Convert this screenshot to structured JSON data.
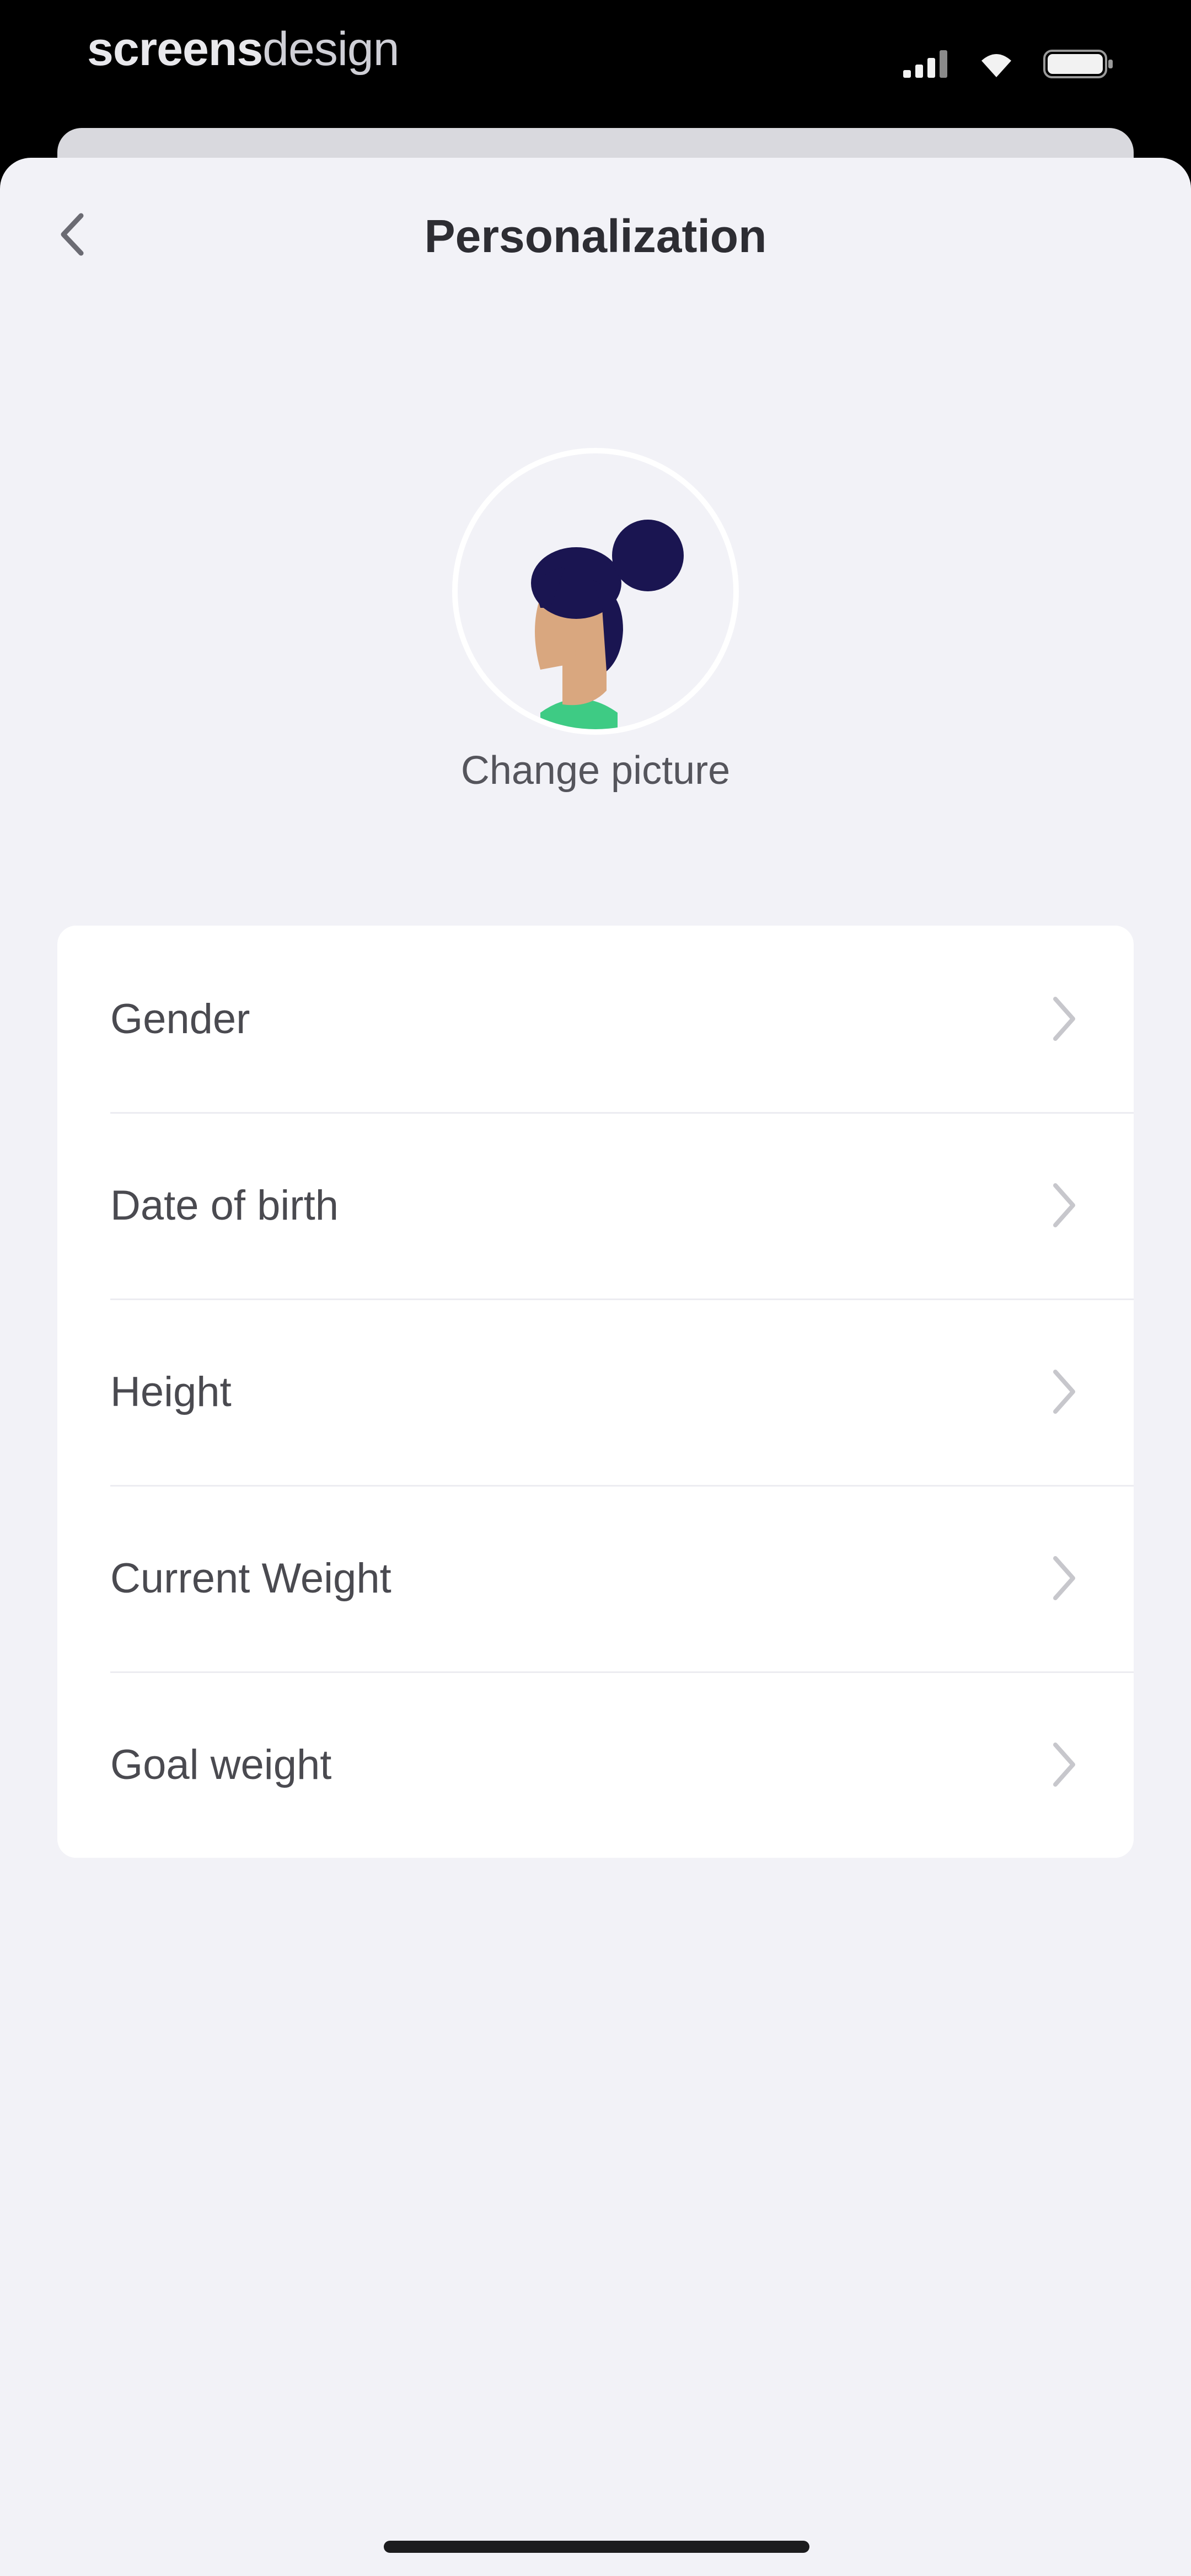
{
  "status_bar": {
    "brand_bold": "screens",
    "brand_light": "design",
    "icons": [
      "cellular-signal-icon",
      "wifi-icon",
      "battery-icon"
    ]
  },
  "nav": {
    "title": "Personalization",
    "back_icon": "chevron-left-icon"
  },
  "profile": {
    "avatar_icon": "woman-avatar-icon",
    "change_picture_label": "Change picture"
  },
  "settings": {
    "rows": [
      {
        "label": "Gender"
      },
      {
        "label": "Date of birth"
      },
      {
        "label": "Height"
      },
      {
        "label": "Current Weight"
      },
      {
        "label": "Goal weight"
      }
    ],
    "chevron_icon": "chevron-right-icon"
  },
  "colors": {
    "background": "#f2f2f7",
    "card": "#ffffff",
    "hair": "#1a1551",
    "skin": "#d9a77f",
    "shirt": "#3ecb84"
  }
}
